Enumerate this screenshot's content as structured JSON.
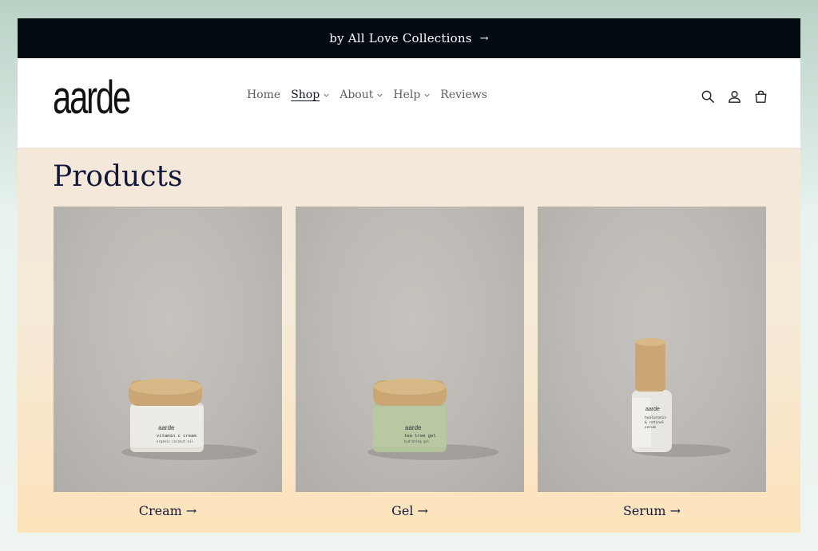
{
  "announcement": {
    "text": "by All Love Collections",
    "arrow": "→"
  },
  "header": {
    "logo": "aarde",
    "nav": [
      {
        "label": "Home",
        "has_dropdown": false
      },
      {
        "label": "Shop",
        "has_dropdown": true,
        "active": true
      },
      {
        "label": "About",
        "has_dropdown": true
      },
      {
        "label": "Help",
        "has_dropdown": true
      },
      {
        "label": "Reviews",
        "has_dropdown": false
      }
    ],
    "icons": [
      "search-icon",
      "account-icon",
      "cart-icon"
    ]
  },
  "main": {
    "title": "Products",
    "products": [
      {
        "label": "Cream →",
        "product_text": [
          "aarde",
          "vitamin c cream",
          "organic coconut oil"
        ],
        "jar_color": "#e4e1db"
      },
      {
        "label": "Gel →",
        "product_text": [
          "aarde",
          "tea tree gel",
          "hydrating gel"
        ],
        "jar_color": "#b2c39c"
      },
      {
        "label": "Serum →",
        "product_text": [
          "aarde",
          "hyaluronic",
          "& retinol",
          "serum"
        ],
        "jar_color": "#e8e6e0"
      }
    ]
  },
  "colors": {
    "announcement_bg": "#040a12",
    "title_color": "#13183a",
    "nav_text": "#5a5f66"
  }
}
